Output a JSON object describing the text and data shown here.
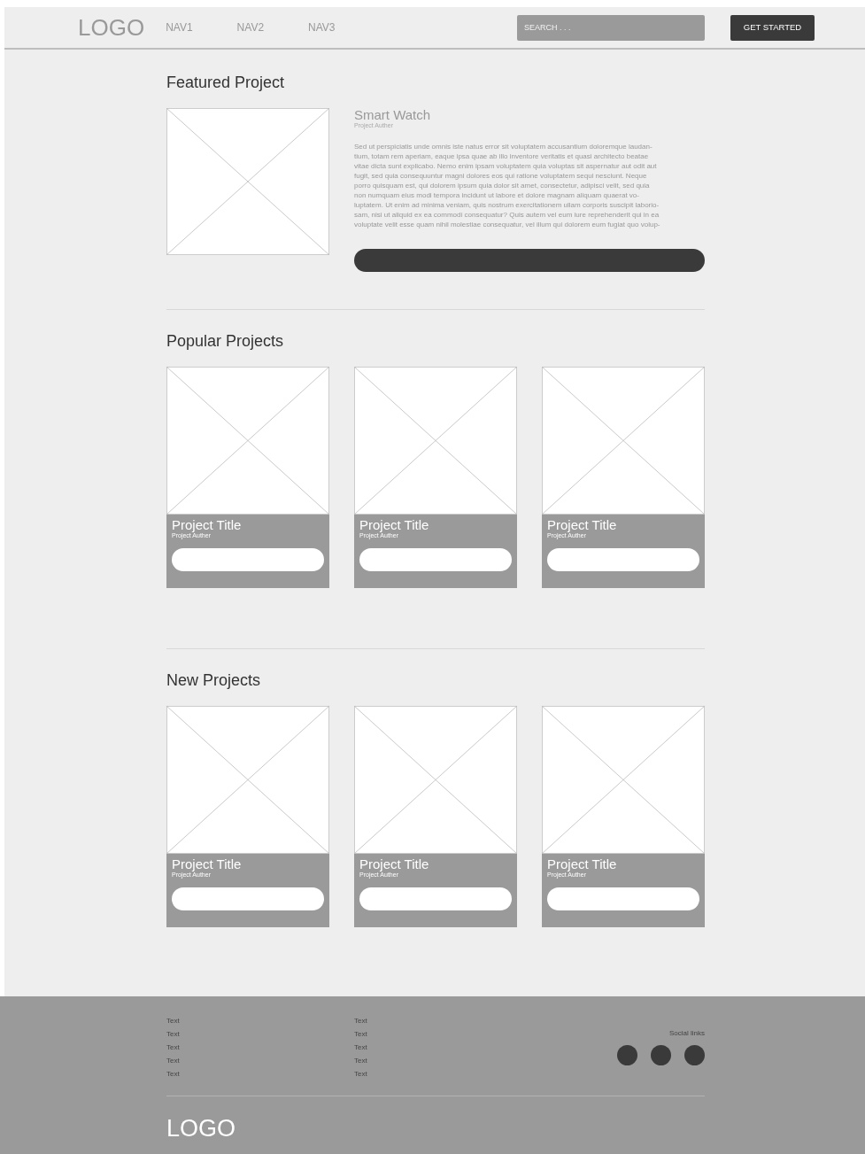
{
  "header": {
    "logo": "LOGO",
    "nav": [
      "NAV1",
      "NAV2",
      "NAV3"
    ],
    "search": {
      "placeholder": "SEARCH . . ."
    },
    "cta": "GET STARTED"
  },
  "featured": {
    "heading": "Featured Project",
    "title": "Smart Watch",
    "author": "Project Auther",
    "description": "Sed ut perspiciatis unde omnis iste natus error sit voluptatem accusantium doloremque laudan-\ntium, totam rem aperiam, eaque ipsa quae ab illo inventore veritatis et quasi architecto beatae\nvitae dicta sunt explicabo. Nemo enim ipsam voluptatem quia voluptas sit aspernatur aut odit aut\nfugit, sed quia consequuntur magni dolores eos qui ratione voluptatem sequi nesciunt. Neque\nporro quisquam est, qui dolorem ipsum quia dolor sit amet, consectetur, adipisci velit, sed quia\nnon numquam eius modi tempora incidunt ut labore et dolore magnam aliquam quaerat vo-\nluptatem. Ut enim ad minima veniam, quis nostrum exercitationem ullam corporis suscipit laborio-\nsam, nisi ut aliquid ex ea commodi consequatur? Quis autem vel eum iure reprehenderit qui in ea\nvoluptate velit esse quam nihil molestiae consequatur, vel illum qui dolorem eum fugiat quo volup-"
  },
  "sections": [
    {
      "heading": "Popular Projects",
      "projects": [
        {
          "title": "Project Title",
          "author": "Project Auther"
        },
        {
          "title": "Project Title",
          "author": "Project Auther"
        },
        {
          "title": "Project Title",
          "author": "Project Auther"
        }
      ]
    },
    {
      "heading": "New Projects",
      "projects": [
        {
          "title": "Project Title",
          "author": "Project Auther"
        },
        {
          "title": "Project Title",
          "author": "Project Auther"
        },
        {
          "title": "Project Title",
          "author": "Project Auther"
        }
      ]
    }
  ],
  "footer": {
    "columns": [
      [
        "Text",
        "Text",
        "Text",
        "Text",
        "Text"
      ],
      [
        "Text",
        "Text",
        "Text",
        "Text",
        "Text"
      ]
    ],
    "social_label": "Social links",
    "logo": "LOGO"
  }
}
